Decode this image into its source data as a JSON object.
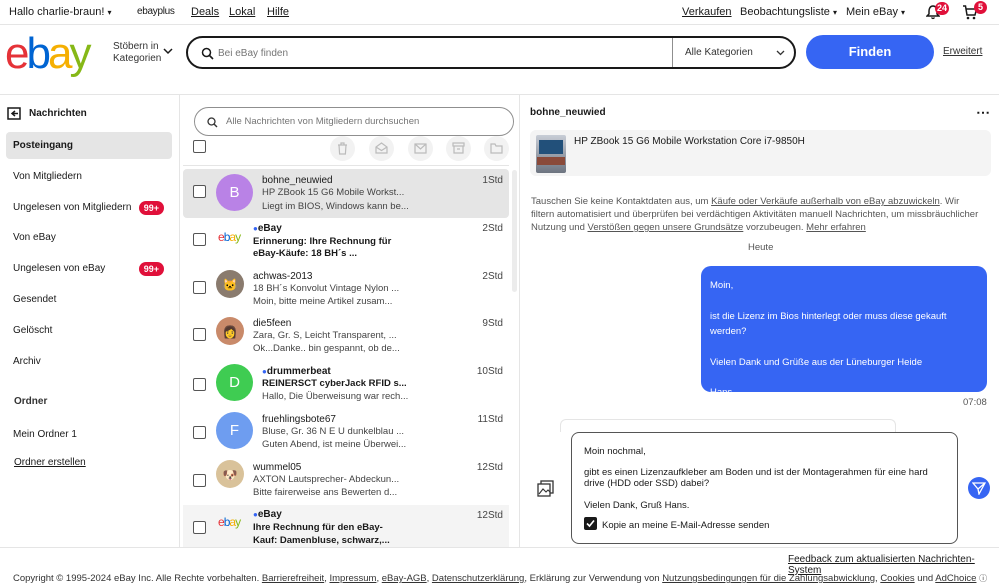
{
  "topbar": {
    "greeting": "Hallo charlie-braun!",
    "ebayplus": "ebayplus",
    "deals": "Deals",
    "lokal": "Lokal",
    "hilfe": "Hilfe",
    "verkaufen": "Verkaufen",
    "watchlist": "Beobachtungsliste",
    "myebay": "Mein eBay",
    "notif_count": "24",
    "cart_count": "5"
  },
  "header": {
    "browse": "Stöbern in Kategorien",
    "search_placeholder": "Bei eBay finden",
    "category": "Alle Kategorien",
    "search_button": "Finden",
    "advanced": "Erweitert"
  },
  "sidebar": {
    "title": "Nachrichten",
    "items": [
      {
        "label": "Posteingang"
      },
      {
        "label": "Von Mitgliedern"
      },
      {
        "label": "Ungelesen von Mitgliedern",
        "badge": "99+"
      },
      {
        "label": "Von eBay"
      },
      {
        "label": "Ungelesen von eBay",
        "badge": "99+"
      },
      {
        "label": "Gesendet"
      },
      {
        "label": "Gelöscht"
      },
      {
        "label": "Archiv"
      }
    ],
    "folders_title": "Ordner",
    "folder1": "Mein Ordner 1",
    "create_folder": "Ordner erstellen"
  },
  "list": {
    "search_placeholder": "Alle Nachrichten von Mitgliedern durchsuchen",
    "messages": [
      {
        "sender": "bohne_neuwied",
        "avatar": "B",
        "line1": "HP ZBook 15 G6 Mobile Workst...",
        "line2": "Liegt im BIOS, Windows kann be...",
        "time": "1Std"
      },
      {
        "sender": "eBay",
        "line1": "Erinnerung: Ihre Rechnung für",
        "line2": "eBay-Käufe:     18 BH´s ...",
        "time": "2Std"
      },
      {
        "sender": "achwas-2013",
        "line1": "18 BH´s Konvolut Vintage Nylon ...",
        "line2": "Moin, bitte meine Artikel zusam...",
        "time": "2Std"
      },
      {
        "sender": "die5feen",
        "line1": "Zara, Gr. S, Leicht Transparent, ...",
        "line2": "Ok...Danke.. bin gespannt, ob de...",
        "time": "9Std"
      },
      {
        "sender": "drummerbeat",
        "avatar": "D",
        "line1": "REINERSCT cyberJack RFID s...",
        "line2": "Hallo, Die Überweisung war rech...",
        "time": "10Std"
      },
      {
        "sender": "fruehlingsbote67",
        "avatar": "F",
        "line1": "Bluse, Gr. 36 N E U dunkelblau ...",
        "line2": "Guten Abend, ist meine Überwei...",
        "time": "11Std"
      },
      {
        "sender": "wummel05",
        "line1": "AXTON Lautsprecher- Abdeckun...",
        "line2": "Bitte fairerweise ans Bewerten d...",
        "time": "12Std"
      },
      {
        "sender": "eBay",
        "line1": "Ihre Rechnung für den eBay-",
        "line2": "Kauf:    Damenbluse, schwarz,...",
        "time": "12Std"
      }
    ]
  },
  "chat": {
    "partner": "bohne_neuwied",
    "item_title": "HP ZBook 15 G6 Mobile Workstation Core i7-9850H",
    "notice_a": "Tauschen Sie keine Kontaktdaten aus, um ",
    "notice_link1": "Käufe oder Verkäufe außerhalb von eBay abzuwickeln",
    "notice_b": ". Wir filtern automatisiert und überprüfen bei verdächtigen Aktivitäten manuell Nachrichten, um missbräuchlicher Nutzung und ",
    "notice_link2": "Verstößen gegen unsere Grundsätze",
    "notice_c": " vorzubeugen. ",
    "notice_link3": "Mehr erfahren",
    "day": "Heute",
    "bubble": {
      "p1": "Moin,",
      "p2": "ist die Lizenz im Bios hinterlegt oder muss diese gekauft werden?",
      "p3": "Vielen Dank und Grüße aus der Lüneburger Heide",
      "p4": "Hans."
    },
    "bubble_time": "07:08",
    "draft": {
      "p1": "Moin nochmal,",
      "p2": "gibt es einen Lizenzaufkleber am Boden und ist der Montagerahmen für eine hard drive (HDD oder SSD) dabei?",
      "p3": "Vielen Dank, Gruß Hans."
    },
    "copy_label": "Kopie an meine E-Mail-Adresse senden",
    "feedback": "Feedback zum aktualisierten Nachrichten-System"
  },
  "footer": {
    "copyright": "Copyright © 1995-2024 eBay Inc. Alle Rechte vorbehalten.",
    "links": [
      "Barrierefreiheit",
      "Impressum",
      "eBay-AGB",
      "Datenschutzerklärung"
    ],
    "text2": "Erklärung zur Verwendung von",
    "link5": "Nutzungsbedingungen für die Zahlungsabwicklung",
    "link6": "Cookies",
    "and": "und",
    "link7": "AdChoice"
  },
  "colors": {
    "accent": "#3665f3",
    "badge": "#e0103a",
    "avatar_b": "#b982e6",
    "avatar_d": "#3fcc52",
    "avatar_f": "#6e9df0"
  }
}
